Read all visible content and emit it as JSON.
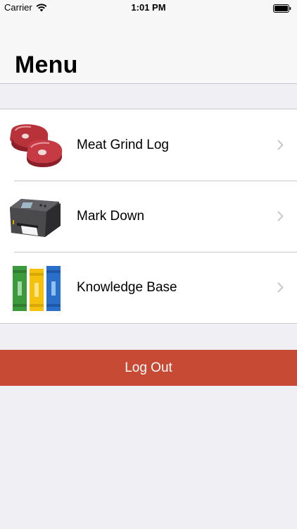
{
  "status_bar": {
    "carrier": "Carrier",
    "time": "1:01 PM",
    "wifi_icon": "wifi-icon",
    "battery_icon": "battery-icon"
  },
  "header": {
    "title": "Menu"
  },
  "menu": {
    "items": [
      {
        "label": "Meat Grind Log",
        "icon": "meat-steak-icon"
      },
      {
        "label": "Mark Down",
        "icon": "label-printer-icon"
      },
      {
        "label": "Knowledge Base",
        "icon": "books-icon"
      }
    ]
  },
  "logout": {
    "label": "Log Out"
  },
  "colors": {
    "background": "#efeff4",
    "header_background": "#f7f7f7",
    "list_background": "#ffffff",
    "separator": "#c8c7cc",
    "chevron": "#c7c7cc",
    "logout_background": "#c64a34",
    "logout_text": "#ffffff"
  }
}
